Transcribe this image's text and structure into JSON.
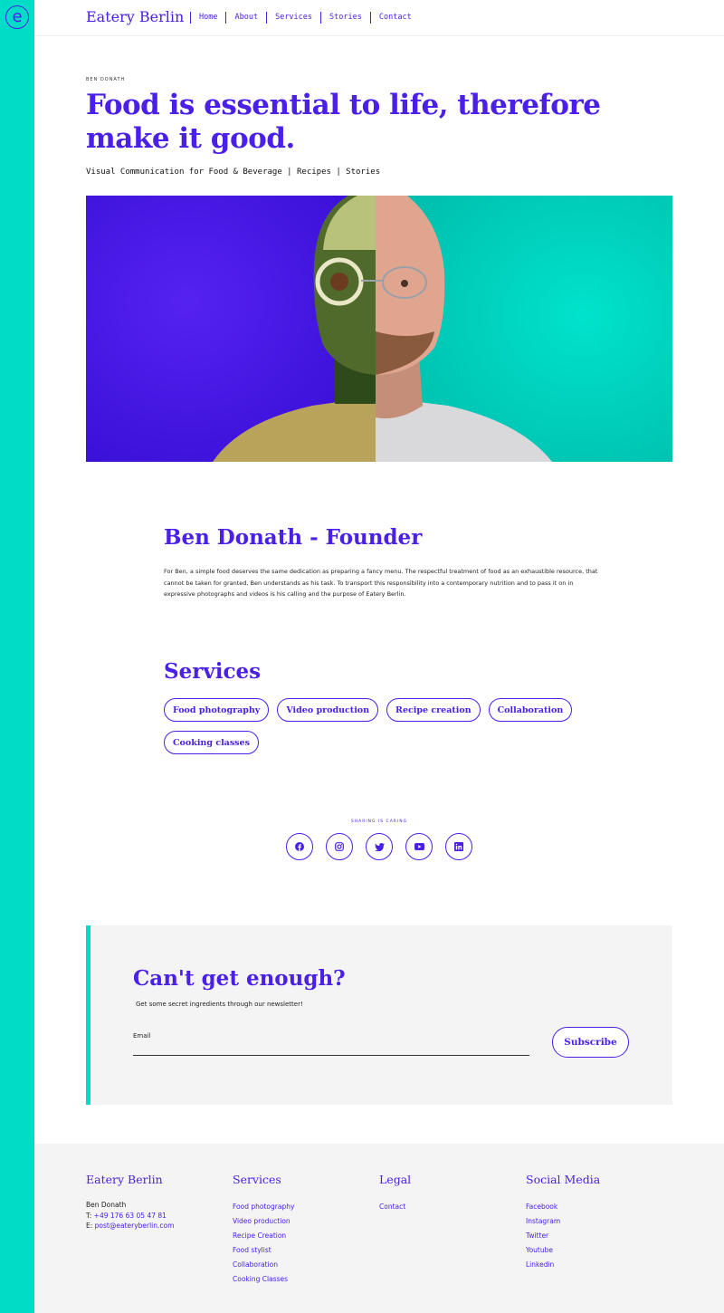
{
  "colors": {
    "accent": "#4A1FE8",
    "teal": "#00DCC6",
    "light_bg": "#f4f4f4"
  },
  "header": {
    "logo_letter": "e",
    "brand": "Eatery Berlin",
    "nav": [
      "Home",
      "About",
      "Services",
      "Stories",
      "Contact"
    ]
  },
  "hero": {
    "eyebrow": "BEN DONATH",
    "title": "Food is essential to life, therefore make it good.",
    "subtitle": "Visual Communication for Food & Beverage | Recipes | Stories"
  },
  "founder": {
    "title": "Ben Donath - Founder",
    "text": "For Ben, a simple food deserves the same dedication as preparing a fancy menu. The respectful treatment of food as an exhaustible resource, that cannot be taken for granted, Ben understands as his task. To transport this responsibility into a contemporary nutrition and to pass it on in expressive photographs and videos is his calling and the purpose of Eatery Berlin."
  },
  "services": {
    "title": "Services",
    "items": [
      "Food photography",
      "Video production",
      "Recipe creation",
      "Collaboration",
      "Cooking classes"
    ]
  },
  "share": {
    "label": "SHARING IS CARING",
    "icons": [
      "facebook-icon",
      "instagram-icon",
      "twitter-icon",
      "youtube-icon",
      "linkedin-icon"
    ]
  },
  "newsletter": {
    "title": "Can't get enough?",
    "subtitle": "Get some secret ingredients through our newsletter!",
    "email_label": "Email",
    "email_value": "",
    "button": "Subscribe"
  },
  "footer": {
    "brand": {
      "title": "Eatery Berlin",
      "name": "Ben Donath",
      "phone_prefix": "T: ",
      "phone": "+49 176 63 05 47 81",
      "email_prefix": "E: ",
      "email": "post@eateryberlin.com"
    },
    "services": {
      "title": "Services",
      "links": [
        "Food photography",
        "Video production",
        "Recipe Creation",
        "Food stylist",
        "Collaboration",
        "Cooking Classes"
      ]
    },
    "legal": {
      "title": "Legal",
      "links": [
        "Contact"
      ]
    },
    "social": {
      "title": "Social Media",
      "links": [
        "Facebook",
        "Instagram",
        "Twitter",
        "Youtube",
        "Linkedin"
      ]
    }
  }
}
